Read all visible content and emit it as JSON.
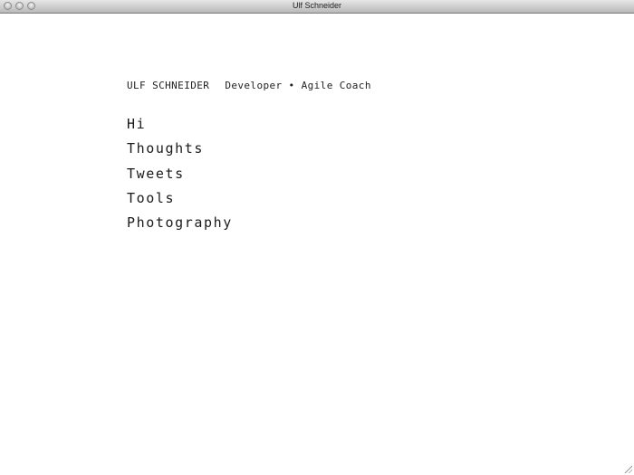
{
  "window": {
    "title": "Ulf Schneider",
    "controls": [
      "close",
      "minimize",
      "zoom"
    ]
  },
  "header": {
    "name": "ULF SCHNEIDER",
    "tagline": "Developer • Agile Coach"
  },
  "nav": {
    "items": [
      {
        "label": "Hi"
      },
      {
        "label": "Thoughts"
      },
      {
        "label": "Tweets"
      },
      {
        "label": "Tools"
      },
      {
        "label": "Photography"
      }
    ]
  }
}
